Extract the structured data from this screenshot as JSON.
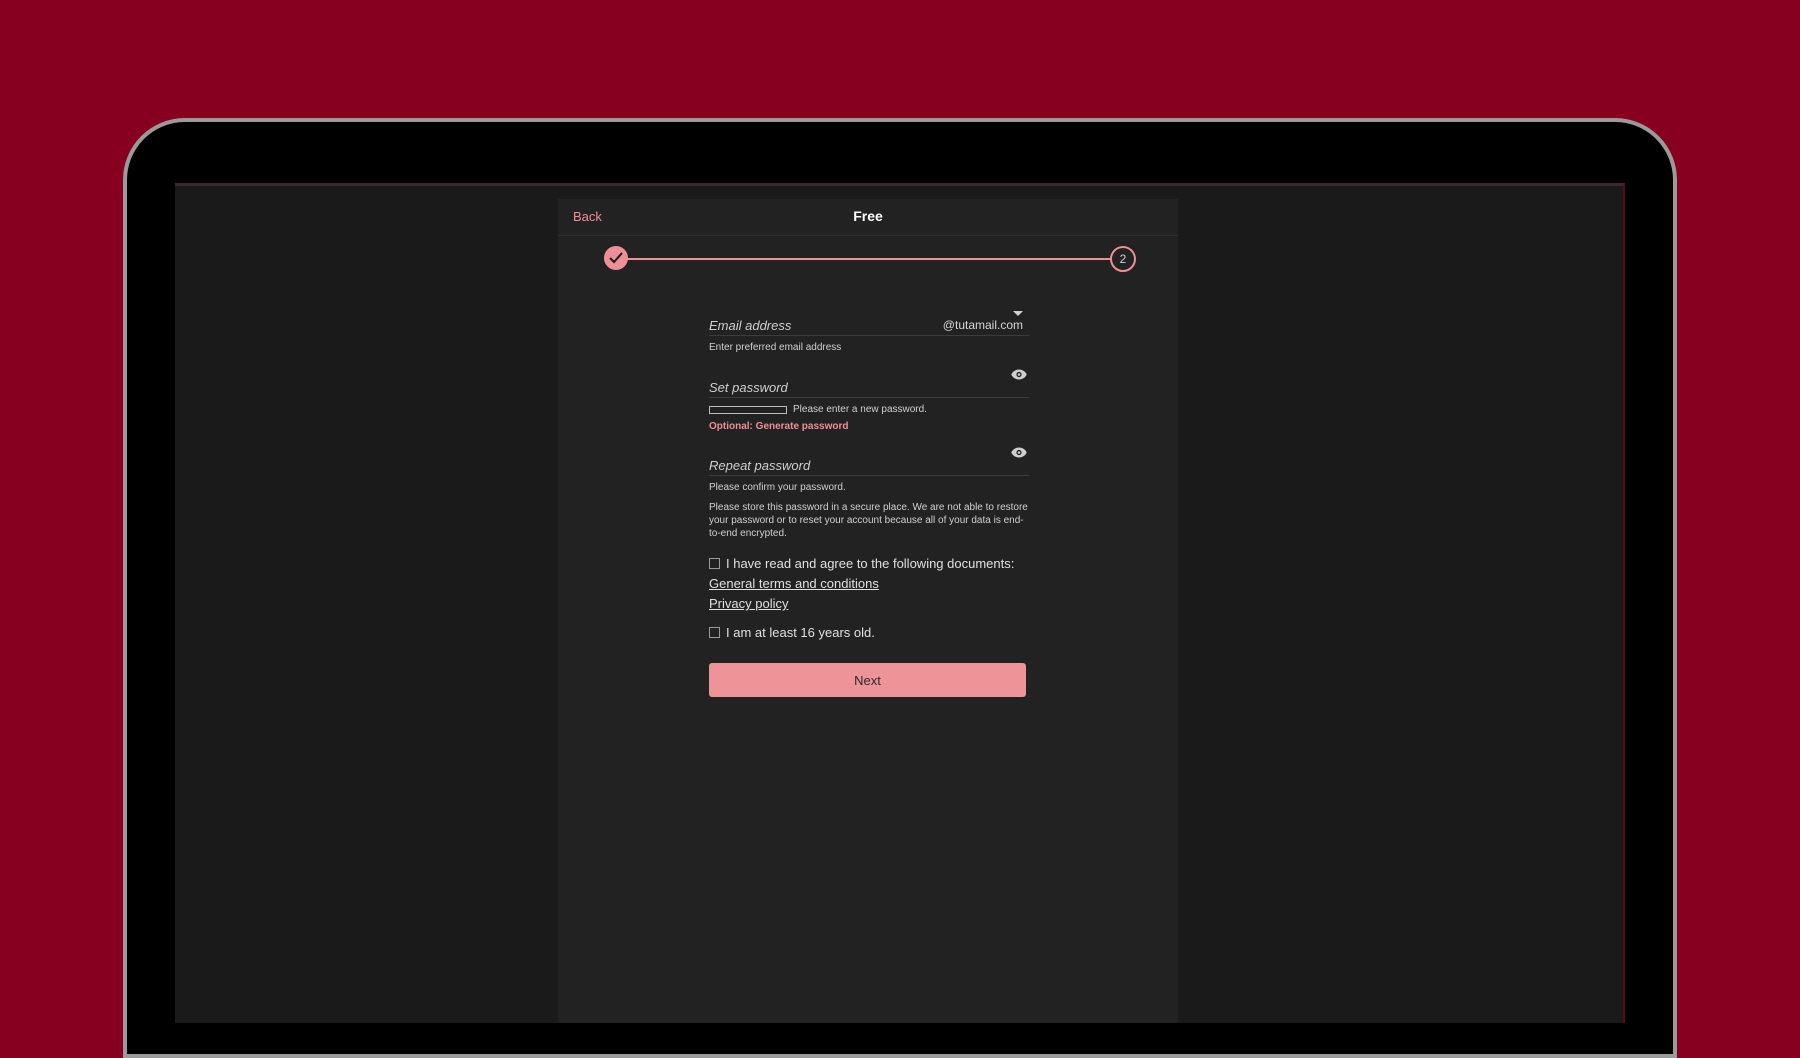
{
  "header": {
    "back_label": "Back",
    "title": "Free"
  },
  "stepper": {
    "current_step": "2",
    "completed_icon": "checkmark-icon"
  },
  "email": {
    "label": "Email address",
    "domain": "@tutamail.com",
    "help": "Enter preferred email address"
  },
  "password": {
    "label": "Set password",
    "strength_text": "Please enter a new password.",
    "generate_label": "Optional: Generate password"
  },
  "repeat_password": {
    "label": "Repeat password",
    "help": "Please confirm your password.",
    "note": "Please store this password in a secure place. We are not able to restore your password or to reset your account because all of your data is end-to-end encrypted."
  },
  "terms": {
    "label": "I have read and agree to the following documents:",
    "general_terms": "General terms and conditions",
    "privacy_policy": "Privacy policy"
  },
  "age": {
    "label": "I am at least 16 years old."
  },
  "next_label": "Next",
  "colors": {
    "background": "#870020",
    "accent": "#ee8e96",
    "panel": "#222222",
    "screen": "#1a1a1a"
  }
}
